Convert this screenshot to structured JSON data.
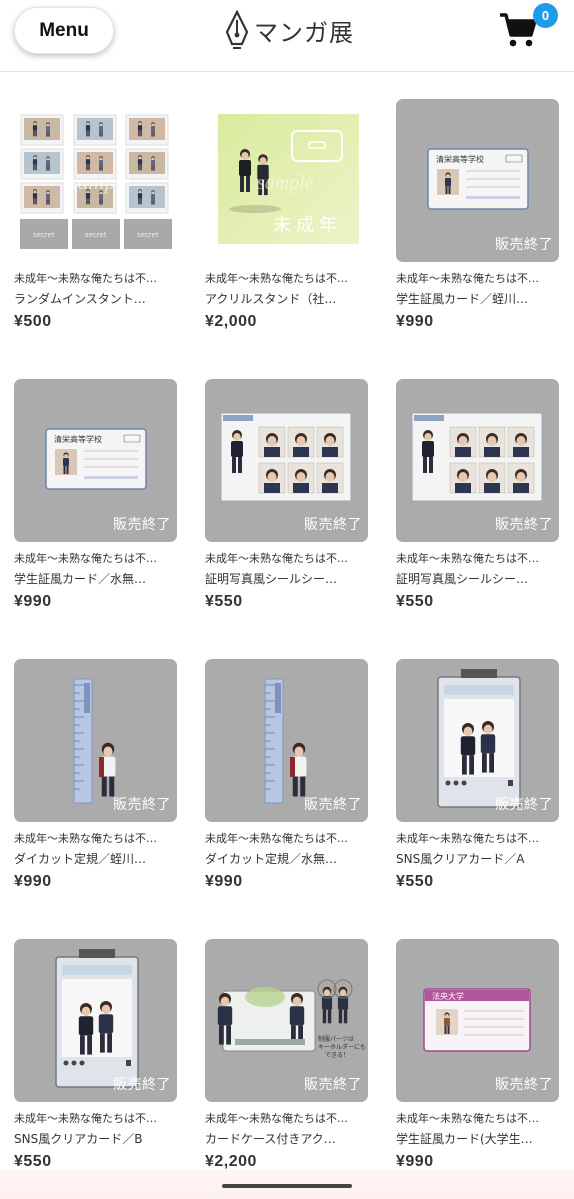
{
  "header": {
    "menu_label": "Menu",
    "logo_text": "マンガ展",
    "cart_count": "0",
    "badge_color": "#1e9be9"
  },
  "sold_out_label": "販売終了",
  "products": [
    {
      "series": "未成年～未熟な俺たちは不…",
      "name": "ランダムインスタント…",
      "price": "¥500",
      "sold_out": false,
      "image": "instant-photo-set"
    },
    {
      "series": "未成年～未熟な俺たちは不…",
      "name": "アクリルスタンド（社…",
      "price": "¥2,000",
      "sold_out": false,
      "image": "acrylic-stand"
    },
    {
      "series": "未成年～未熟な俺たちは不…",
      "name": "学生証風カード／蛭川…",
      "price": "¥990",
      "sold_out": true,
      "image": "student-id-card"
    },
    {
      "series": "未成年～未熟な俺たちは不…",
      "name": "学生証風カード／水無…",
      "price": "¥990",
      "sold_out": true,
      "image": "student-id-card"
    },
    {
      "series": "未成年～未熟な俺たちは不…",
      "name": "証明写真風シールシー…",
      "price": "¥550",
      "sold_out": true,
      "image": "photo-sticker-sheet"
    },
    {
      "series": "未成年～未熟な俺たちは不…",
      "name": "証明写真風シールシー…",
      "price": "¥550",
      "sold_out": true,
      "image": "photo-sticker-sheet"
    },
    {
      "series": "未成年～未熟な俺たちは不…",
      "name": "ダイカット定規／蛭川…",
      "price": "¥990",
      "sold_out": true,
      "image": "diecut-ruler"
    },
    {
      "series": "未成年～未熟な俺たちは不…",
      "name": "ダイカット定規／水無…",
      "price": "¥990",
      "sold_out": true,
      "image": "diecut-ruler"
    },
    {
      "series": "未成年～未熟な俺たちは不…",
      "name": "SNS風クリアカード／A",
      "price": "¥550",
      "sold_out": true,
      "image": "sns-clear-card"
    },
    {
      "series": "未成年～未熟な俺たちは不…",
      "name": "SNS風クリアカード／B",
      "price": "¥550",
      "sold_out": true,
      "image": "sns-clear-card"
    },
    {
      "series": "未成年～未熟な俺たちは不…",
      "name": "カードケース付きアク…",
      "price": "¥2,200",
      "sold_out": true,
      "image": "card-case"
    },
    {
      "series": "未成年～未熟な俺たちは不…",
      "name": "学生証風カード(大学生…",
      "price": "¥990",
      "sold_out": true,
      "image": "college-id-card"
    }
  ]
}
